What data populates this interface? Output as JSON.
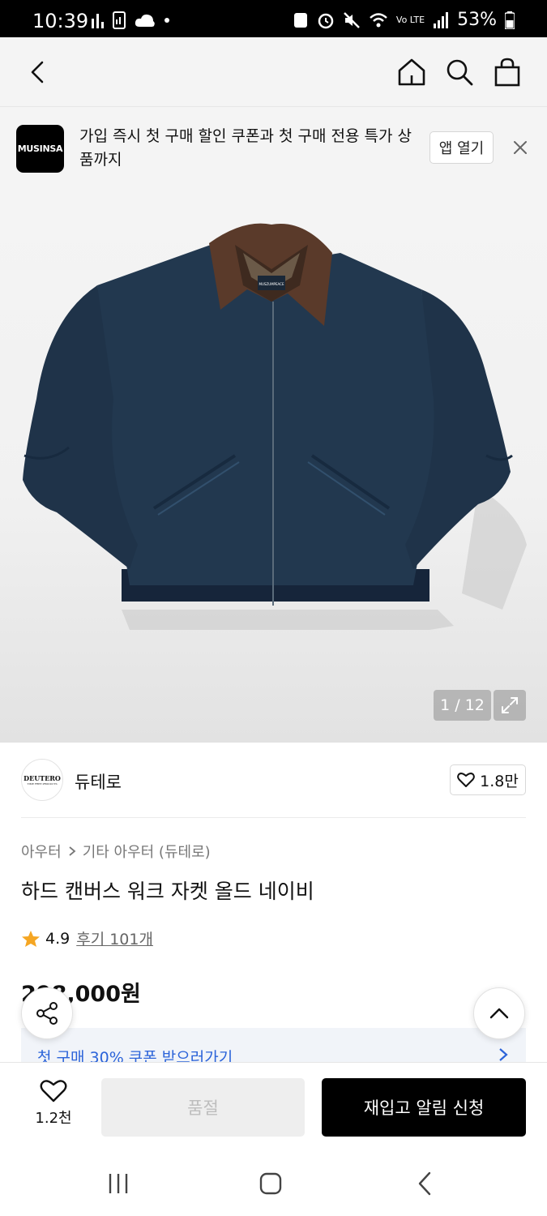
{
  "status_bar": {
    "time": "10:39",
    "battery": "53%",
    "network": "Vo LTE"
  },
  "header": {
    "icons": [
      "back-icon",
      "home-icon",
      "search-icon",
      "shopping-bag-icon"
    ]
  },
  "promo": {
    "logo_text": "MUSINSA",
    "text": "가입 즉시 첫 구매 할인 쿠폰과 첫 구매 전용 특가 상품까지",
    "open_label": "앱 열기"
  },
  "gallery": {
    "counter": "1 / 12",
    "collar_label": "MUSZUMPEACE"
  },
  "brand": {
    "logo_text": "DEUTERO",
    "logo_subtext": "TIME FREE PRODUCTS",
    "name": "듀테로",
    "likes": "1.8만"
  },
  "product": {
    "breadcrumb_1": "아우터",
    "breadcrumb_2": "기타 아우터 (듀테로)",
    "title": "하드 캔버스 워크 자켓 올드 네이비",
    "rating": "4.9",
    "reviews": "후기 101개",
    "price": "298,000원"
  },
  "coupon": {
    "text": "첫 구매 30% 쿠폰 받으러가기"
  },
  "actions": {
    "wish_count": "1.2천",
    "soldout_label": "품절",
    "restock_label": "재입고 알림 신청"
  },
  "colors": {
    "accent_blue": "#2b63d9",
    "star": "#f5a623",
    "jacket": "#22384f",
    "collar": "#5a3a2a"
  }
}
